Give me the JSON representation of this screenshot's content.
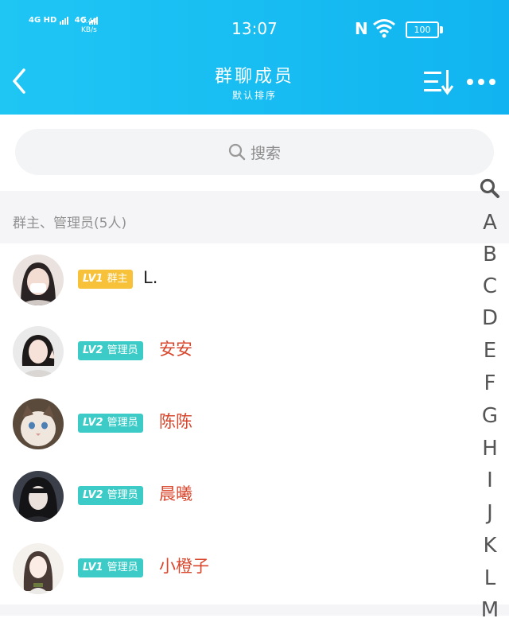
{
  "status_bar": {
    "network_1": "4G HD",
    "network_2": "4G",
    "speed_value": "0.40",
    "speed_unit": "KB/s",
    "time": "13:07",
    "nfc": "N",
    "battery": "100"
  },
  "header": {
    "title": "群聊成员",
    "subtitle": "默认排序",
    "back_icon": "chevron-left-icon",
    "sort_icon": "sort-icon",
    "more_icon": "more-dots-icon"
  },
  "search": {
    "placeholder": "搜索",
    "icon": "search-icon"
  },
  "group": {
    "header": "群主、管理员(5人)"
  },
  "members": [
    {
      "level": "LV1",
      "role": "群主",
      "name": "L.",
      "badge_color": "#f7c23a",
      "name_color": "#222222"
    },
    {
      "level": "LV2",
      "role": "管理员",
      "name": "安安",
      "badge_color": "#3ccbc6",
      "name_color": "#d8462c"
    },
    {
      "level": "LV2",
      "role": "管理员",
      "name": "陈陈",
      "badge_color": "#3ccbc6",
      "name_color": "#d8462c"
    },
    {
      "level": "LV2",
      "role": "管理员",
      "name": "晨曦",
      "badge_color": "#3ccbc6",
      "name_color": "#d8462c"
    },
    {
      "level": "LV1",
      "role": "管理员",
      "name": "小橙子",
      "badge_color": "#3ccbc6",
      "name_color": "#d8462c"
    }
  ],
  "index": {
    "search_icon": "search-icon",
    "letters": [
      "A",
      "B",
      "C",
      "D",
      "E",
      "F",
      "G",
      "H",
      "I",
      "J",
      "K",
      "L",
      "M"
    ]
  },
  "colors": {
    "accent": "#14b9f2",
    "owner_badge": "#f7c23a",
    "admin_badge": "#3ccbc6"
  }
}
